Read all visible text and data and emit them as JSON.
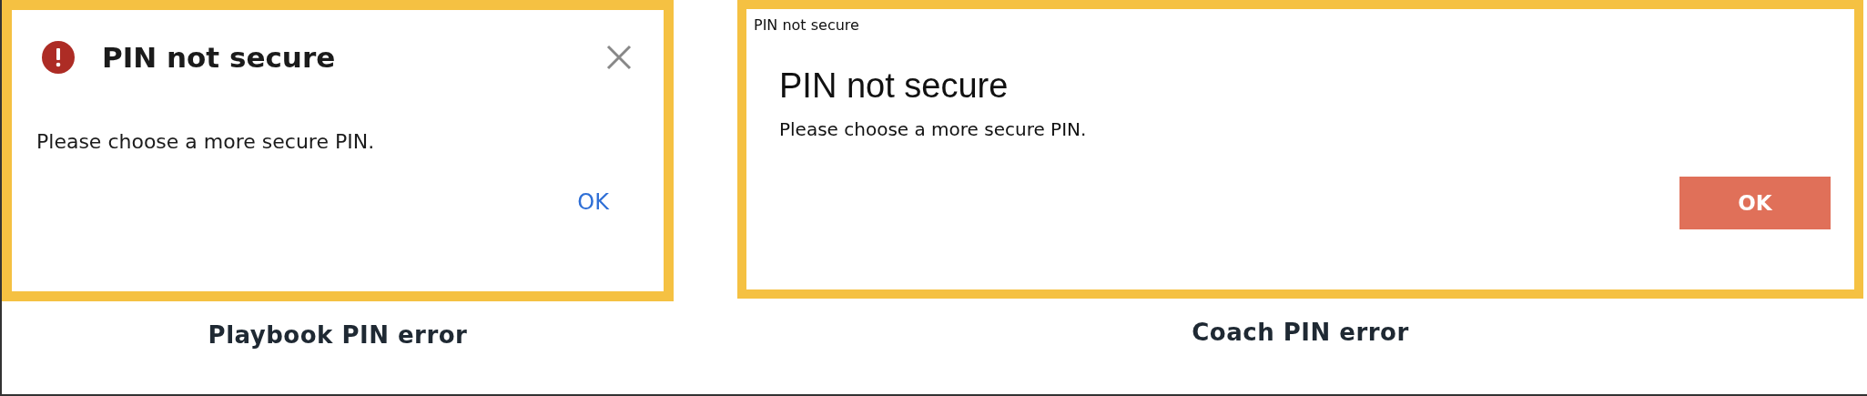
{
  "dialogs": [
    {
      "kind": "modern",
      "title": "PIN not secure",
      "message": "Please choose a more secure PIN.",
      "button": "OK",
      "caption": "Playbook PIN error"
    },
    {
      "kind": "classic",
      "window_title": "PIN not secure",
      "title": "PIN not secure",
      "message": "Please choose a more secure PIN.",
      "button": "OK",
      "caption": "Coach PIN error"
    }
  ]
}
